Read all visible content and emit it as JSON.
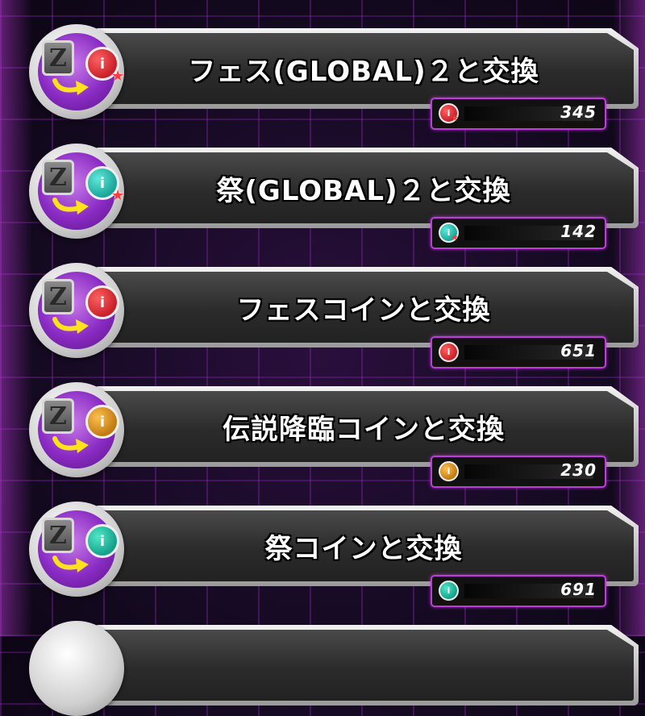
{
  "exchange_list": {
    "items": [
      {
        "label": "フェス(GLOBAL)２と交換",
        "count": "345",
        "coin_color": "#c8202a",
        "coin_glow": "#ff6060",
        "star": true,
        "coin_icon": "fes-global-coin-icon"
      },
      {
        "label": "祭(GLOBAL)２と交換",
        "count": "142",
        "coin_color": "#1aa59a",
        "coin_glow": "#60e8d8",
        "star": true,
        "coin_icon": "matsuri-global-coin-icon"
      },
      {
        "label": "フェスコインと交換",
        "count": "651",
        "coin_color": "#c8202a",
        "coin_glow": "#ff6060",
        "star": false,
        "coin_icon": "fes-coin-icon"
      },
      {
        "label": "伝説降臨コインと交換",
        "count": "230",
        "coin_color": "#c07a10",
        "coin_glow": "#ffc050",
        "star": false,
        "coin_icon": "legend-coin-icon"
      },
      {
        "label": "祭コインと交換",
        "count": "691",
        "coin_color": "#14a08a",
        "coin_glow": "#50e8c8",
        "star": false,
        "coin_icon": "matsuri-coin-icon"
      }
    ]
  },
  "icons": {
    "z_tile": "z-medal-icon",
    "arrow": "exchange-arrow-icon",
    "star": "star-icon"
  },
  "coin_glyph": "i",
  "z_glyph": "Z",
  "star_glyph": "★"
}
